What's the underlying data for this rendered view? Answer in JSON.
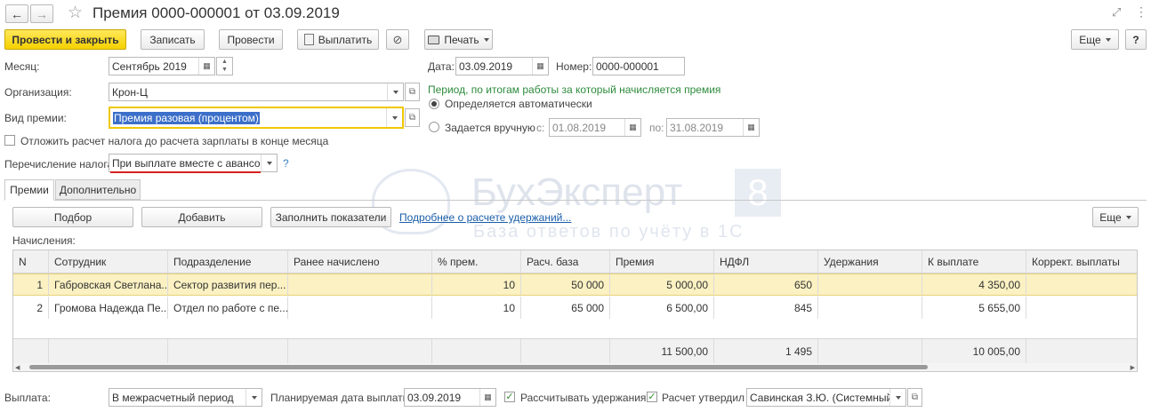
{
  "window": {
    "title": "Премия 0000-000001 от 03.09.2019"
  },
  "toolbar": {
    "post_close": "Провести и закрыть",
    "write": "Записать",
    "post": "Провести",
    "pay": "Выплатить",
    "print": "Печать",
    "more": "Еще",
    "help": "?"
  },
  "header": {
    "month_label": "Месяц:",
    "month_value": "Сентябрь 2019",
    "org_label": "Организация:",
    "org_value": "Крон-Ц",
    "bonus_type_label": "Вид премии:",
    "bonus_type_value": "Премия разовая (процентом)",
    "defer_tax_label": "Отложить расчет налога до расчета зарплаты в конце месяца",
    "tax_transfer_label": "Перечисление налога:",
    "tax_transfer_value": "При выплате вместе с авансом",
    "tax_help": "?",
    "date_label": "Дата:",
    "date_value": "03.09.2019",
    "number_label": "Номер:",
    "number_value": "0000-000001",
    "period_title": "Период, по итогам работы за который начисляется премия",
    "period_auto": "Определяется автоматически",
    "period_manual": "Задается вручную",
    "from_label": "с:",
    "from_value": "01.08.2019",
    "to_label": "по:",
    "to_value": "31.08.2019"
  },
  "tabs": [
    {
      "label": "Премии"
    },
    {
      "label": "Дополнительно"
    }
  ],
  "table_toolbar": {
    "select": "Подбор",
    "add": "Добавить",
    "fill": "Заполнить показатели",
    "details_link": "Подробнее о расчете удержаний...",
    "more": "Еще"
  },
  "accruals_label": "Начисления:",
  "columns": [
    "N",
    "Сотрудник",
    "Подразделение",
    "Ранее начислено",
    "% прем.",
    "Расч. база",
    "Премия",
    "НДФЛ",
    "Удержания",
    "К выплате",
    "Коррект. выплаты"
  ],
  "rows": [
    {
      "n": "1",
      "employee": "Габровская Светлана...",
      "dept": "Сектор развития пер...",
      "prev": "",
      "pct": "10",
      "base": "50 000",
      "bonus": "5 000,00",
      "ndfl": "650",
      "ded": "",
      "pay": "4 350,00",
      "corr": ""
    },
    {
      "n": "2",
      "employee": "Громова Надежда Пе...",
      "dept": "Отдел по работе с пе...",
      "prev": "",
      "pct": "10",
      "base": "65 000",
      "bonus": "6 500,00",
      "ndfl": "845",
      "ded": "",
      "pay": "5 655,00",
      "corr": ""
    }
  ],
  "totals": {
    "bonus": "11 500,00",
    "ndfl": "1 495",
    "pay": "10 005,00"
  },
  "footer": {
    "payment_label": "Выплата:",
    "payment_value": "В межрасчетный период",
    "planned_date_label": "Планируемая дата выплаты:",
    "planned_date_value": "03.09.2019",
    "calc_deductions": "Рассчитывать удержания",
    "approved_label": "Расчет утвердил",
    "approver_value": "Савинская З.Ю. (Системный п"
  },
  "watermark": {
    "brand": "БухЭксперт",
    "digit": "8",
    "tagline": "База ответов по учёту в 1С"
  },
  "colors": {
    "accent_yellow": "#f5d100",
    "link_blue": "#1a5ea8",
    "period_green": "#2e8b3d",
    "selected_row": "#fbf1c2",
    "red_underline": "#d62020"
  }
}
